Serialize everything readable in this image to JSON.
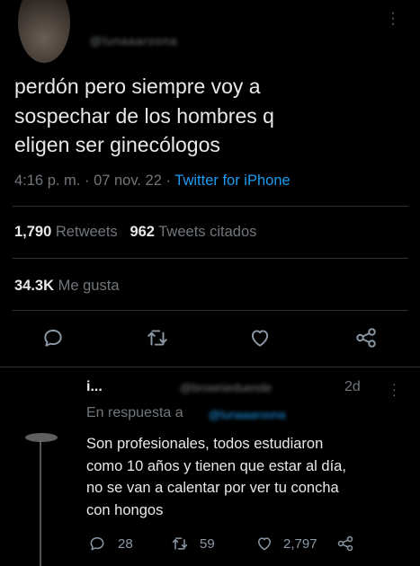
{
  "tweet": {
    "handle": "@lunaaaroona",
    "text_lines": [
      "perdón pero siempre voy a",
      "sospechar de los hombres q",
      "eligen ser ginecólogos"
    ],
    "time": "4:16 p. m.",
    "date": "07 nov. 22",
    "source": "Twitter for iPhone",
    "separator": "·",
    "retweets_count": "1,790",
    "retweets_label": "Retweets",
    "quotes_count": "962",
    "quotes_label": "Tweets citados",
    "likes_count": "34.3K",
    "likes_label": "Me gusta"
  },
  "reply": {
    "name": "i...",
    "handle": "@brownieduende",
    "time": "2d",
    "replying_prefix": "En respuesta a",
    "replying_to": "@lunaaaroona",
    "text_lines": [
      "Son profesionales, todos estudiaron",
      "como 10 años y tienen que estar al día,",
      "no se van a calentar por ver tu concha",
      "con hongos"
    ],
    "reply_count": "28",
    "retweet_count": "59",
    "like_count": "2,797"
  },
  "colors": {
    "background": "#000000",
    "text": "#e7e9ea",
    "muted": "#71767b",
    "accent": "#1d9bf0",
    "divider": "#2f3336"
  },
  "icons": {
    "reply": "reply-icon",
    "retweet": "retweet-icon",
    "like": "heart-icon",
    "share": "share-icon",
    "more": "more-vertical-icon"
  }
}
